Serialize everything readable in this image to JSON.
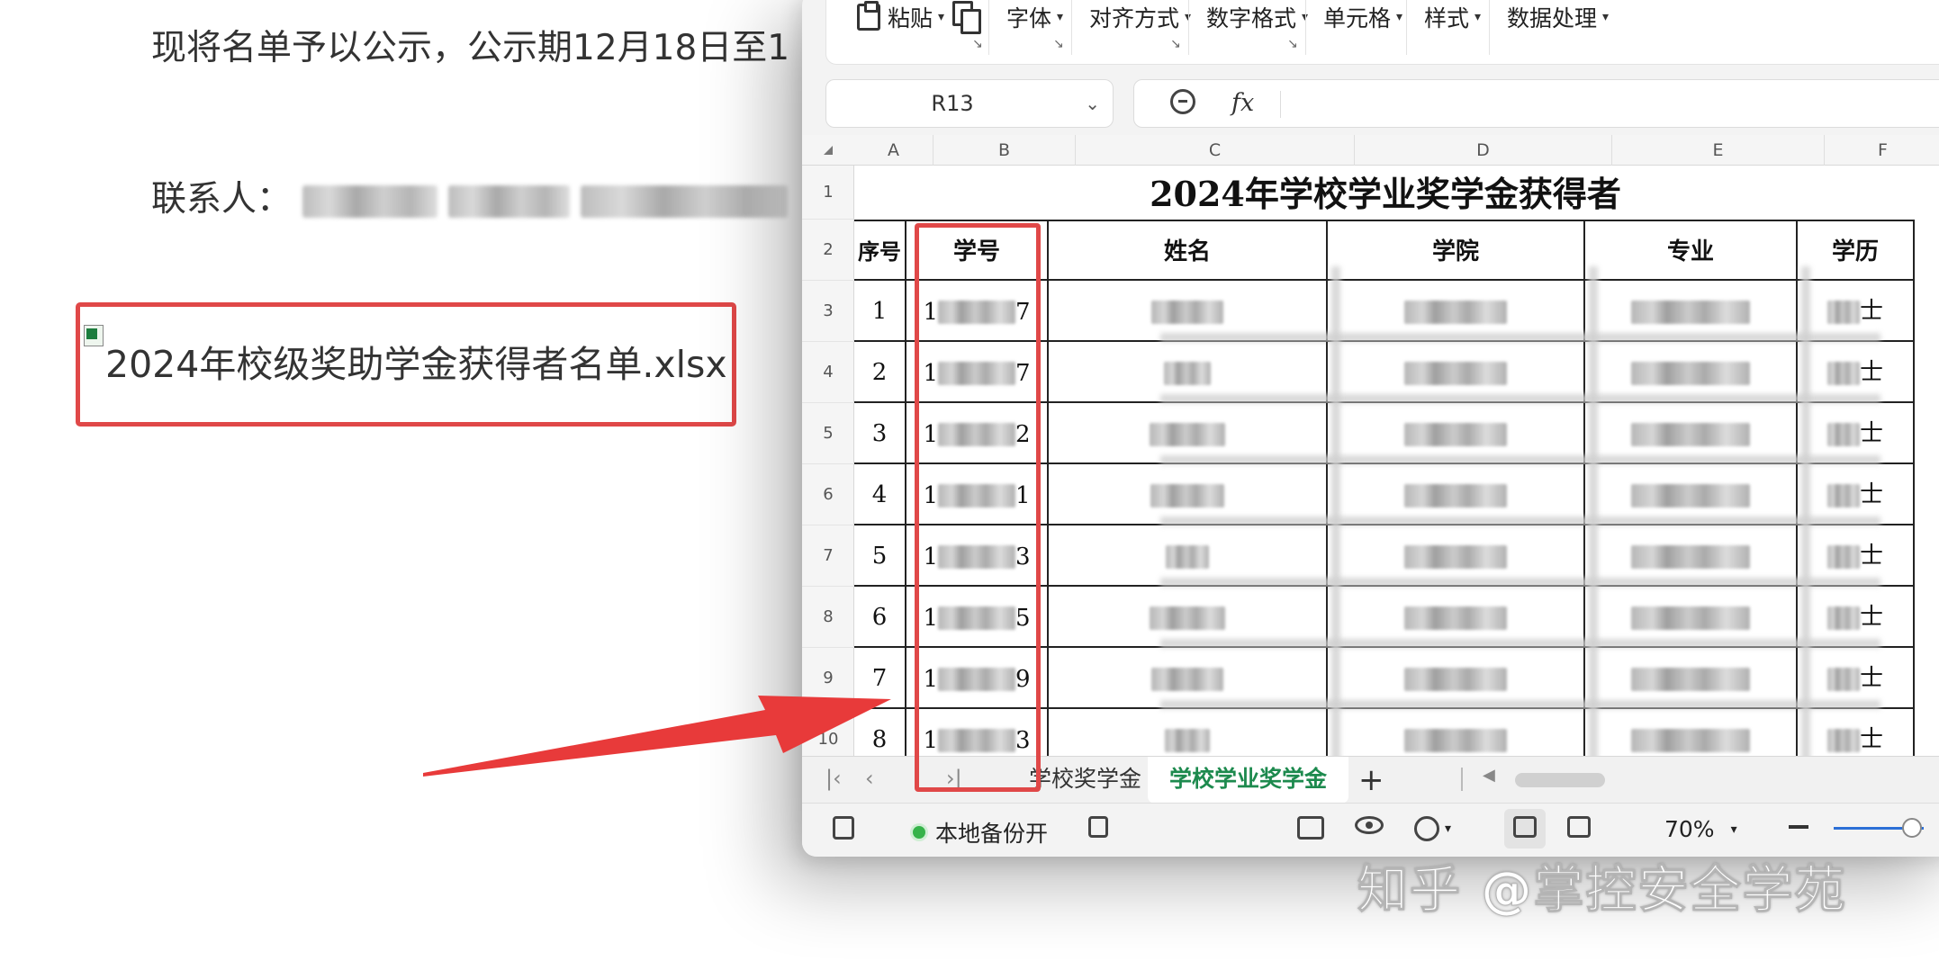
{
  "document": {
    "notice_text": "现将名单予以公示，公示期12月18日至1",
    "contact_label": "联系人：",
    "attachment_name": "2024年校级奖助学金获得者名单.xlsx"
  },
  "ribbon": {
    "paste_label": "粘贴",
    "font_label": "字体",
    "align_label": "对齐方式",
    "number_format_label": "数字格式",
    "cell_label": "单元格",
    "style_label": "样式",
    "data_label": "数据处理"
  },
  "formula_bar": {
    "name_box": "R13",
    "fx_label": "fx",
    "formula": ""
  },
  "sheet": {
    "columns": [
      "A",
      "B",
      "C",
      "D",
      "E",
      "F"
    ],
    "rows": [
      "1",
      "2",
      "3",
      "4",
      "5",
      "6",
      "7",
      "8",
      "9",
      "10"
    ],
    "title": "2024年学校学业奖学金获得者",
    "headers": [
      "序号",
      "学号",
      "姓名",
      "学院",
      "专业",
      "学历"
    ],
    "records": [
      {
        "seq": "1",
        "id_first": "1",
        "id_last": "7",
        "degree_tail": "士"
      },
      {
        "seq": "2",
        "id_first": "1",
        "id_last": "7",
        "degree_tail": "士"
      },
      {
        "seq": "3",
        "id_first": "1",
        "id_last": "2",
        "degree_tail": "士"
      },
      {
        "seq": "4",
        "id_first": "1",
        "id_last": "1",
        "degree_tail": "士"
      },
      {
        "seq": "5",
        "id_first": "1",
        "id_last": "3",
        "degree_tail": "士"
      },
      {
        "seq": "6",
        "id_first": "1",
        "id_last": "5",
        "degree_tail": "士"
      },
      {
        "seq": "7",
        "id_first": "1",
        "id_last": "9",
        "degree_tail": "士"
      },
      {
        "seq": "8",
        "id_first": "1",
        "id_last": "3",
        "degree_tail": "士"
      }
    ]
  },
  "tabs": {
    "tab1": "学校奖学金",
    "tab2": "学校学业奖学金",
    "add": "+"
  },
  "status": {
    "backup": "本地备份开",
    "zoom": "70%"
  },
  "watermark": "知乎 @掌控安全学苑",
  "colors": {
    "highlight_red": "#e04848",
    "active_tab_green": "#1d8a4e",
    "backup_dot_green": "#36b34a"
  }
}
